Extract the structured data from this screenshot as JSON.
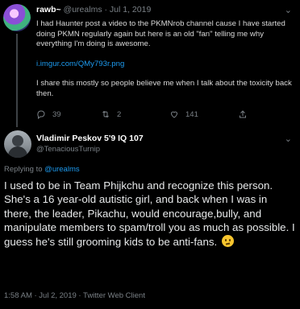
{
  "parent_tweet": {
    "display_name": "rawb~",
    "handle": "@urealms",
    "separator": "·",
    "date": "Jul 1, 2019",
    "paragraph_1": "I had Haunter post a video to the PKMNrob channel cause I have started doing PKMN regularly again but here is an old \"fan\" telling me why everything I'm doing is awesome.",
    "link": "i.imgur.com/QMy793r.png",
    "paragraph_2": "I share this mostly so people believe me when I talk about the toxicity back then.",
    "reply_count": "39",
    "retweet_count": "2",
    "like_count": "141"
  },
  "focal_tweet": {
    "display_name": "Vladimir Peskov 5'9 IQ 107",
    "handle": "@TenaciousTurnip",
    "replying_prefix": "Replying to ",
    "replying_to": "@urealms",
    "text": "I used to be in Team Phijkchu and recognize this person. She's a 16 year-old autistic girl, and back when I was in there, the leader, Pikachu, would encourage,bully, and manipulate members to spam/troll you as much as possible. I guess he's still grooming kids to be anti-fans.",
    "emoji_icon": "confused-face-icon",
    "meta": "1:58 AM · Jul 2, 2019 · Twitter Web Client"
  },
  "icons": {
    "more": "chevron-down-icon",
    "reply": "reply-icon",
    "retweet": "retweet-icon",
    "like": "heart-icon",
    "share": "share-icon"
  },
  "colors": {
    "background": "#000000",
    "link": "#1d9bf0",
    "muted": "#7a8086"
  }
}
